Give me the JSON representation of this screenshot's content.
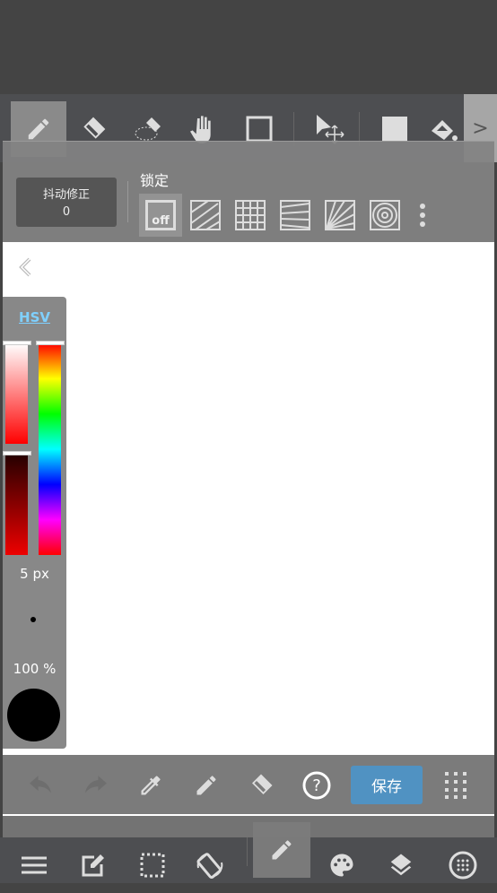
{
  "toolbar": {
    "tools": [
      "pen",
      "eraser",
      "lasso-eraser",
      "hand",
      "rectangle",
      "move",
      "fill-color",
      "bucket"
    ],
    "selected": "pen",
    "next_label": ">"
  },
  "stabilizer": {
    "label": "抖动修正",
    "value": "0"
  },
  "lock": {
    "label": "锁定",
    "off_label": "off",
    "options": [
      "off",
      "parallel",
      "grid",
      "perspective",
      "radial",
      "concentric"
    ],
    "selected": "off"
  },
  "color_panel": {
    "mode": "HSV",
    "size": "5 px",
    "opacity": "100 %",
    "color": "#000000",
    "accent": "#7fd0ff"
  },
  "bottombar": {
    "save_label": "保存",
    "save_color": "#5092c2"
  },
  "nav": {
    "items": [
      "menu",
      "edit",
      "selection",
      "rotate",
      "pen",
      "palette",
      "layers",
      "material"
    ],
    "selected": "pen"
  }
}
